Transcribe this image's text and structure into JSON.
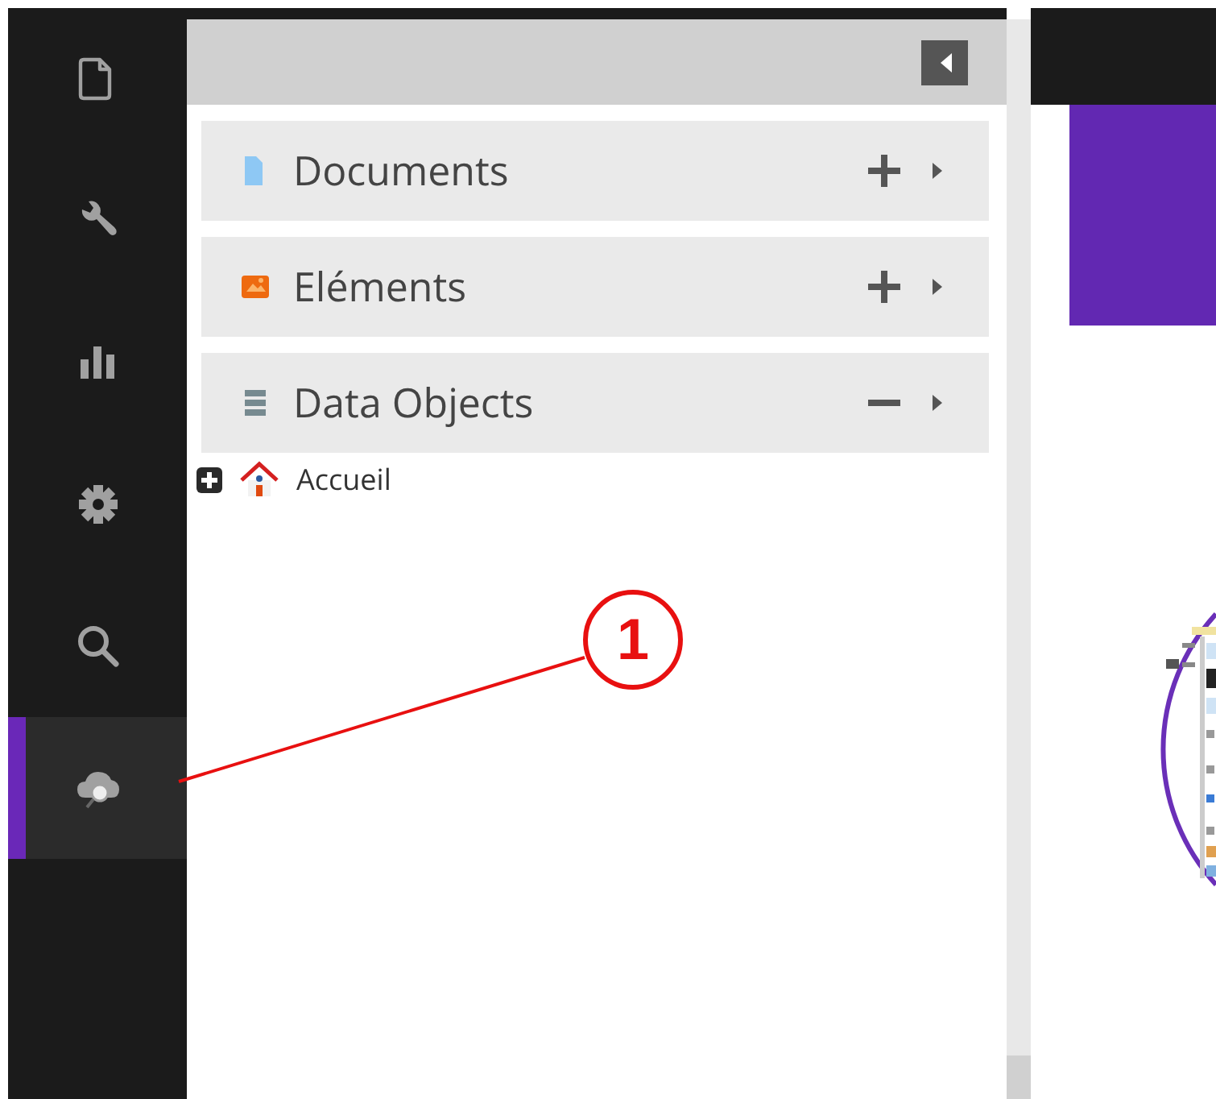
{
  "rail": {
    "items": [
      {
        "kind": "document",
        "selected": false
      },
      {
        "kind": "wrench",
        "selected": false
      },
      {
        "kind": "chart",
        "selected": false
      },
      {
        "kind": "gear",
        "selected": false
      },
      {
        "kind": "search",
        "selected": false
      },
      {
        "kind": "cloud",
        "selected": true
      }
    ]
  },
  "panel": {
    "sections": [
      {
        "label": "Documents",
        "kind": "document",
        "expanded": false
      },
      {
        "label": "Eléments",
        "kind": "image",
        "expanded": false
      },
      {
        "label": "Data Objects",
        "kind": "database",
        "expanded": true
      }
    ],
    "tree": [
      {
        "label": "Accueil",
        "expanded": false
      }
    ]
  },
  "callout": {
    "number": "1"
  }
}
